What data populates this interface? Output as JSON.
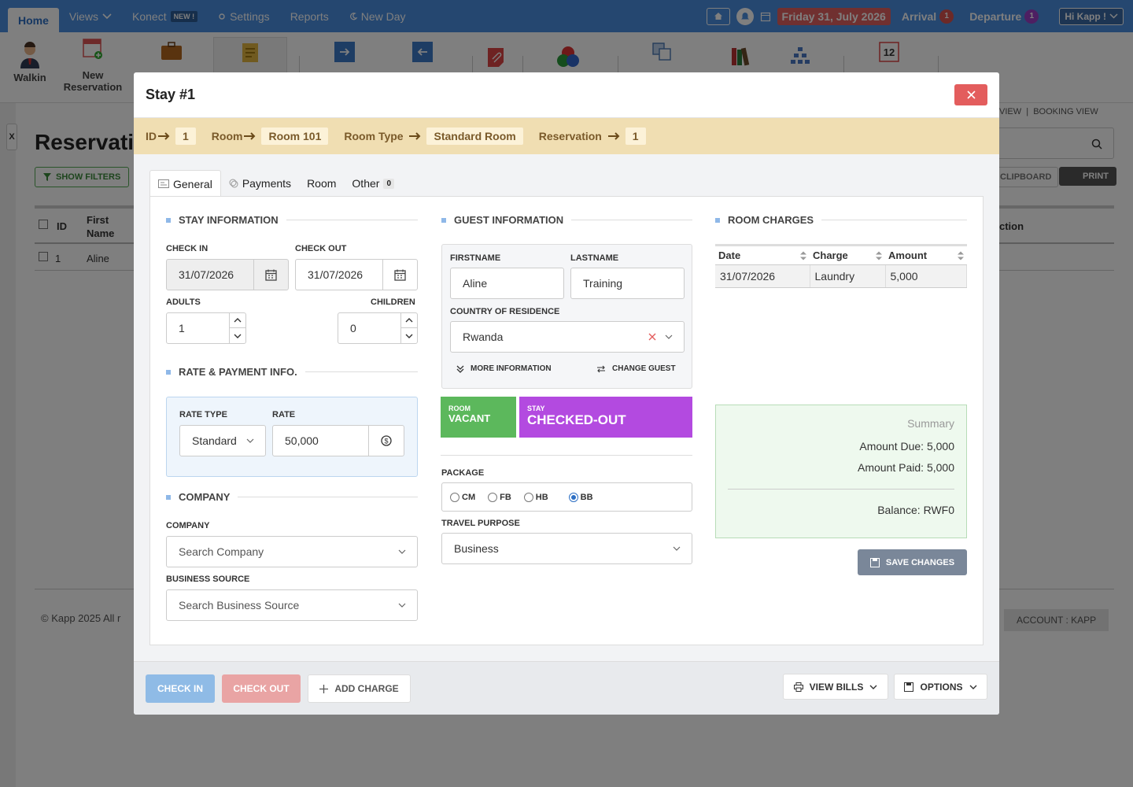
{
  "nav": {
    "items": [
      {
        "label": "Home"
      },
      {
        "label": "Views"
      },
      {
        "label": "Konect",
        "badge": "NEW !"
      },
      {
        "label": "Settings"
      },
      {
        "label": "Reports"
      },
      {
        "label": "New Day"
      }
    ],
    "date": "Friday 31, July 2026",
    "arrival_label": "Arrival",
    "arrival_count": "1",
    "departure_label": "Departure",
    "departure_count": "1",
    "user": "Hi Kapp !"
  },
  "toolbar": {
    "walkin": "Walkin",
    "new_reservation": "New Reservation"
  },
  "background": {
    "page_title": "Reservati",
    "show_filters": "SHOW FILTERS",
    "view_links": "VIEW  |  BOOKING VIEW",
    "clipboard": "CLIPBOARD",
    "print": "PRINT",
    "col_id": "ID",
    "col_first": "First Name",
    "col_action": "ction",
    "row_id": "1",
    "row_name": "Aline",
    "footer_left": "© Kapp 2025 All r",
    "footer_right": "ACCOUNT : KAPP"
  },
  "modal": {
    "title": "Stay #1",
    "crumbs": {
      "id_label": "ID",
      "id_value": "1",
      "room_label": "Room",
      "room_value": "Room 101",
      "room_type_label": "Room Type",
      "room_type_value": "Standard Room",
      "reservation_label": "Reservation",
      "reservation_value": "1"
    },
    "tabs": {
      "general": "General",
      "payments": "Payments",
      "room": "Room",
      "other": "Other",
      "other_count": "0"
    },
    "stay": {
      "heading": "STAY INFORMATION",
      "check_in_label": "CHECK IN",
      "check_in": "31/07/2026",
      "check_out_label": "CHECK OUT",
      "check_out": "31/07/2026",
      "adults_label": "ADULTS",
      "adults": "1",
      "children_label": "CHILDREN",
      "children": "0"
    },
    "rate": {
      "heading": "RATE & PAYMENT INFO.",
      "rate_type_label": "RATE TYPE",
      "rate_type": "Standard",
      "rate_label": "RATE",
      "rate": "50,000"
    },
    "company": {
      "heading": "COMPANY",
      "company_label": "COMPANY",
      "company_placeholder": "Search Company",
      "source_label": "BUSINESS SOURCE",
      "source_placeholder": "Search Business Source"
    },
    "guest": {
      "heading": "GUEST INFORMATION",
      "firstname_label": "FIRSTNAME",
      "firstname": "Aline",
      "lastname_label": "LASTNAME",
      "lastname": "Training",
      "country_label": "COUNTRY OF RESIDENCE",
      "country": "Rwanda",
      "more_info": "MORE INFORMATION",
      "change_guest": "CHANGE GUEST",
      "room_status_label": "ROOM",
      "room_status": "VACANT",
      "stay_status_label": "STAY",
      "stay_status": "CHECKED-OUT",
      "package_label": "PACKAGE",
      "packages": [
        "CM",
        "FB",
        "HB",
        "BB"
      ],
      "package_selected": "BB",
      "purpose_label": "TRAVEL PURPOSE",
      "purpose": "Business"
    },
    "charges": {
      "heading": "ROOM CHARGES",
      "columns": [
        "Date",
        "Charge",
        "Amount"
      ],
      "rows": [
        [
          "31/07/2026",
          "Laundry",
          "5,000"
        ]
      ]
    },
    "summary": {
      "title": "Summary",
      "amount_due": "Amount Due: 5,000",
      "amount_paid": "Amount Paid: 5,000",
      "balance": "Balance: RWF0"
    },
    "save_changes": "SAVE CHANGES",
    "footer": {
      "check_in": "CHECK IN",
      "check_out": "CHECK OUT",
      "add_charge": "ADD CHARGE",
      "view_bills": "VIEW BILLS",
      "options": "OPTIONS"
    }
  },
  "colors": {
    "nav_bg": "#4a8ee0",
    "crumb_bg": "#f0deb2",
    "room_status_bg": "#5cb85c",
    "stay_status_bg": "#b34ae0",
    "close_btn": "#e35d5d"
  }
}
